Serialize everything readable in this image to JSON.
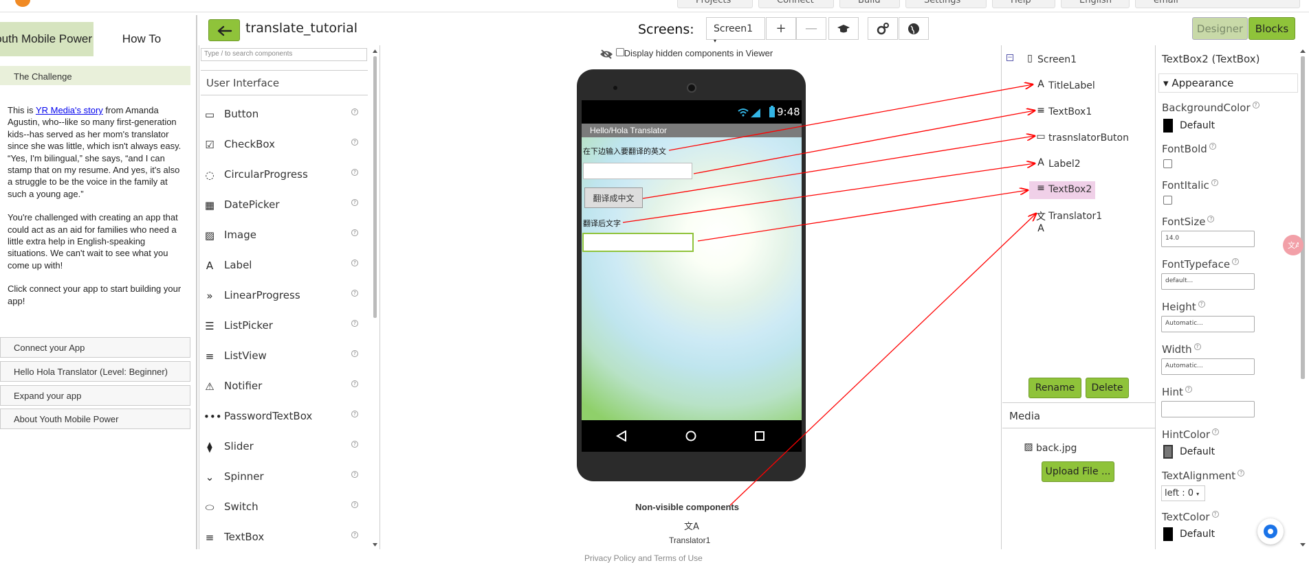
{
  "topbar": {
    "items": [
      "Projects",
      "Connect",
      "Build",
      "Settings",
      "Help",
      "English",
      "email"
    ]
  },
  "tutorial": {
    "tabs": [
      "Youth Mobile Power",
      "How To"
    ],
    "section_title": "The Challenge",
    "p1_prefix": "This is ",
    "p1_link": "YR Media's story",
    "p1_rest": " from Amanda Agustin, who--like so many first-generation kids--has served as her mom's translator since she was little, which isn't always easy. “Yes, I'm bilingual,” she says, “and I can stamp that on my resume. And yes, it's also a struggle to be the voice in the family at such a young age.”",
    "p2": "You're challenged with creating an app that could act as an aid for families who need a little extra help in English-speaking situations. We can't wait to see what you come up with!",
    "p3": "Click connect your app to start building your app!",
    "steps": [
      "Connect your App",
      "Hello Hola Translator (Level: Beginner)",
      "Expand your app",
      "About Youth Mobile Power"
    ]
  },
  "header": {
    "project_title": "translate_tutorial",
    "screens_label": "Screens:",
    "screen_selected": "Screen1",
    "add_screen": "+",
    "remove_screen": "—",
    "designer_label": "Designer",
    "blocks_label": "Blocks"
  },
  "palette": {
    "search_placeholder": "Type / to search components",
    "category": "User Interface",
    "items": [
      {
        "label": "Button",
        "icon": "button-icon",
        "glyph": "▭"
      },
      {
        "label": "CheckBox",
        "icon": "checkbox-icon",
        "glyph": "☑"
      },
      {
        "label": "CircularProgress",
        "icon": "circular-progress-icon",
        "glyph": "◌"
      },
      {
        "label": "DatePicker",
        "icon": "datepicker-icon",
        "glyph": "▦"
      },
      {
        "label": "Image",
        "icon": "image-icon",
        "glyph": "▨"
      },
      {
        "label": "Label",
        "icon": "label-icon",
        "glyph": "A"
      },
      {
        "label": "LinearProgress",
        "icon": "linear-progress-icon",
        "glyph": "»"
      },
      {
        "label": "ListPicker",
        "icon": "listpicker-icon",
        "glyph": "☰"
      },
      {
        "label": "ListView",
        "icon": "listview-icon",
        "glyph": "≡"
      },
      {
        "label": "Notifier",
        "icon": "notifier-icon",
        "glyph": "⚠"
      },
      {
        "label": "PasswordTextBox",
        "icon": "password-icon",
        "glyph": "•••"
      },
      {
        "label": "Slider",
        "icon": "slider-icon",
        "glyph": "⧫"
      },
      {
        "label": "Spinner",
        "icon": "spinner-icon",
        "glyph": "⌄"
      },
      {
        "label": "Switch",
        "icon": "switch-icon",
        "glyph": "⬭"
      },
      {
        "label": "TextBox",
        "icon": "textbox-icon",
        "glyph": "≡"
      }
    ]
  },
  "viewer": {
    "hidden_toggle": "Display hidden components in Viewer",
    "status_time": "9:48",
    "app_title": "Hello/Hola Translator",
    "label1": "在下边输入要翻译的英文",
    "button_text": "翻译成中文",
    "label2": "翻译后文字",
    "nonvisible_label": "Non-visible components",
    "nonvisible_item": "Translator1",
    "footer": "Privacy Policy and Terms of Use"
  },
  "components": {
    "tree": [
      {
        "label": "Screen1",
        "icon": "screen-icon",
        "glyph": "▯"
      },
      {
        "label": "TitleLabel",
        "icon": "label-icon",
        "glyph": "A"
      },
      {
        "label": "TextBox1",
        "icon": "textbox-icon",
        "glyph": "≡"
      },
      {
        "label": "trasnslatorButon",
        "icon": "button-icon",
        "glyph": "▭"
      },
      {
        "label": "Label2",
        "icon": "label-icon",
        "glyph": "A"
      },
      {
        "label": "TextBox2",
        "icon": "textbox-icon",
        "glyph": "≡"
      },
      {
        "label": "Translator1",
        "icon": "translator-icon",
        "glyph": "文A"
      }
    ],
    "rename": "Rename",
    "delete": "Delete",
    "media_header": "Media",
    "media_file": "back.jpg",
    "upload": "Upload File ..."
  },
  "properties": {
    "title": "TextBox2 (TextBox)",
    "group": "Appearance",
    "background_color": "BackgroundColor",
    "background_color_value": "Default",
    "font_bold": "FontBold",
    "font_italic": "FontItalic",
    "font_size": "FontSize",
    "font_size_value": "14.0",
    "font_typeface": "FontTypeface",
    "font_typeface_value": "default...",
    "height": "Height",
    "height_value": "Automatic...",
    "width": "Width",
    "width_value": "Automatic...",
    "hint": "Hint",
    "hint_color": "HintColor",
    "hint_color_value": "Default",
    "text_alignment": "TextAlignment",
    "text_alignment_value": "left : 0",
    "text_color": "TextColor",
    "text_color_value": "Default"
  },
  "colors": {
    "accent_green": "#8fc33a",
    "annotation_red": "#ff0000",
    "selection_pink": "#f0d0e8"
  }
}
